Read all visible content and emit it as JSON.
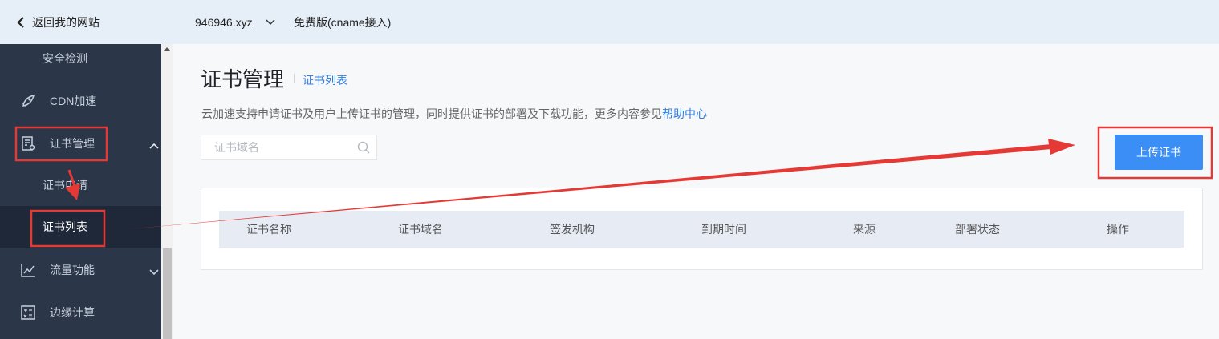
{
  "topbar": {
    "back_label": "返回我的网站",
    "domain": "946946.xyz",
    "plan": "免费版(cname接入)"
  },
  "sidebar": {
    "items": [
      {
        "label": "安全检测",
        "icon": "none"
      },
      {
        "label": "CDN加速",
        "icon": "rocket-icon"
      },
      {
        "label": "证书管理",
        "icon": "certificate-icon",
        "expanded": true
      },
      {
        "label": "证书申请"
      },
      {
        "label": "证书列表",
        "active": true
      },
      {
        "label": "流量功能",
        "icon": "chart-icon",
        "expanded": false
      },
      {
        "label": "边缘计算",
        "icon": "calculator-icon"
      }
    ]
  },
  "main": {
    "title": "证书管理",
    "breadcrumb": "证书列表",
    "desc_text": "云加速支持申请证书及用户上传证书的管理，同时提供证书的部署及下载功能，更多内容参见",
    "desc_link": "帮助中心",
    "search_placeholder": "证书域名",
    "upload_button": "上传证书",
    "table": {
      "columns": [
        "证书名称",
        "证书域名",
        "签发机构",
        "到期时间",
        "来源",
        "部署状态",
        "操作"
      ],
      "rows": []
    }
  },
  "colors": {
    "accent": "#3a8ef6",
    "link": "#2f7de1",
    "sidebar_bg": "#2b3648",
    "topbar_bg": "#e6eef7",
    "annotation": "#e53935"
  }
}
